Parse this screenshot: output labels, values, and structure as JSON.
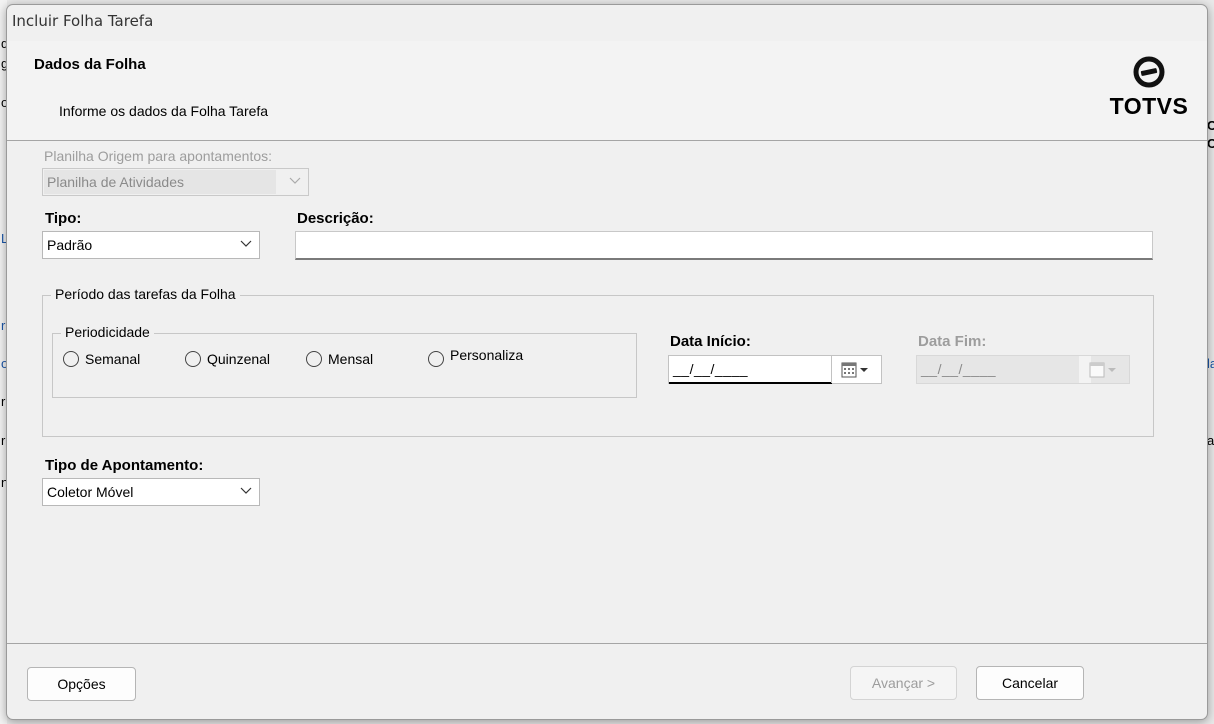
{
  "window": {
    "title": "Incluir Folha Tarefa"
  },
  "header": {
    "title": "Dados da Folha",
    "subtitle": "Informe os dados da Folha Tarefa",
    "logo_text": "TOTVS"
  },
  "form": {
    "origem": {
      "label": "Planilha Origem para apontamentos:",
      "value": "Planilha de Atividades"
    },
    "tipo": {
      "label": "Tipo:",
      "value": "Padrão"
    },
    "descricao": {
      "label": "Descrição:",
      "value": ""
    },
    "periodo": {
      "group_title": "Período das tarefas da Folha",
      "periodicidade": {
        "title": "Periodicidade",
        "options": [
          "Semanal",
          "Quinzenal",
          "Mensal",
          "Personaliza"
        ]
      },
      "data_inicio": {
        "label": "Data Início:",
        "value": "__/__/____"
      },
      "data_fim": {
        "label": "Data Fim:",
        "value": "__/__/____"
      }
    },
    "tipo_apontamento": {
      "label": "Tipo de Apontamento:",
      "value": "Coletor Móvel"
    }
  },
  "footer": {
    "options_label": "Opções",
    "next_label": "Avançar >",
    "cancel_label": "Cancelar"
  },
  "colors": {
    "link": "#1a55a8",
    "disabled_text": "#9d9d9d"
  }
}
